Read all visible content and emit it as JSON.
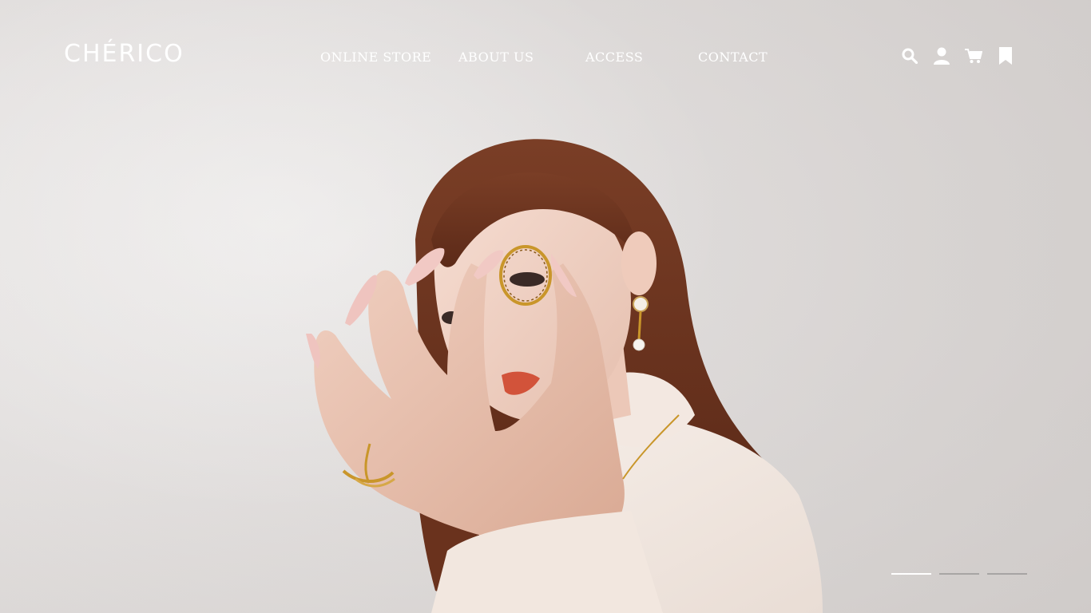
{
  "brand": {
    "logo_text": "CHÉRICO"
  },
  "nav": {
    "items": [
      {
        "label": "ONLINE STORE"
      },
      {
        "label": "ABOUT US"
      },
      {
        "label": "ACCESS"
      },
      {
        "label": "CONTACT"
      }
    ]
  },
  "header_icons": [
    "search-icon",
    "account-icon",
    "cart-icon",
    "bookmark-icon"
  ],
  "hero": {
    "slides_total": 3,
    "active_slide": 1
  },
  "colors": {
    "nav_text": "#ffffff",
    "background": "#e4e1e0",
    "ring_gold": "#c9962a",
    "hair": "#7a3a22"
  }
}
